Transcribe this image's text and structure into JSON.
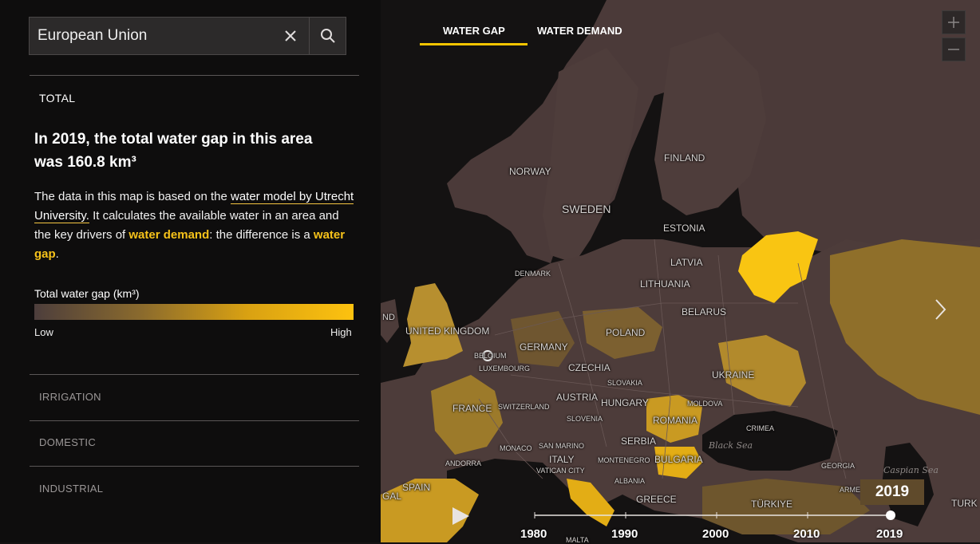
{
  "search": {
    "value": "European Union"
  },
  "categories": {
    "total": "TOTAL",
    "irrigation": "IRRIGATION",
    "domestic": "DOMESTIC",
    "industrial": "INDUSTRIAL"
  },
  "summary": {
    "headline_line1": "In 2019, the total water gap in this area",
    "headline_line2": "was 160.8 km³",
    "desc_part1": "The data in this map is based on the ",
    "desc_link1": "water model by Utrecht University.",
    "desc_part2": " It calculates the available water in an area and the key drivers of ",
    "desc_link2": "water demand",
    "desc_part3": ": the difference is a ",
    "desc_link3": "water gap",
    "desc_part4": "."
  },
  "legend": {
    "title": "Total water gap (km³)",
    "low": "Low",
    "high": "High"
  },
  "tabs": {
    "water_gap": "WATER GAP",
    "water_demand": "WATER DEMAND"
  },
  "zoom": {
    "in": "+",
    "out": "−"
  },
  "countries": {
    "norway": "NORWAY",
    "sweden": "SWEDEN",
    "finland": "FINLAND",
    "estonia": "ESTONIA",
    "latvia": "LATVIA",
    "lithuania": "LITHUANIA",
    "denmark": "DENMARK",
    "belarus": "BELARUS",
    "united_kingdom": "UNITED KINGDOM",
    "ireland_partial": "ND",
    "poland": "POLAND",
    "germany": "GERMANY",
    "belgium": "BELGIUM",
    "luxembourg": "LUXEMBOURG",
    "czechia": "CZECHIA",
    "slovakia": "SLOVAKIA",
    "ukraine": "UKRAINE",
    "austria": "AUSTRIA",
    "hungary": "HUNGARY",
    "moldova": "MOLDOVA",
    "france": "FRANCE",
    "switzerland": "SWITZERLAND",
    "slovenia": "SLOVENIA",
    "romania": "ROMANIA",
    "crimea": "CRIMEA",
    "serbia": "SERBIA",
    "monaco": "MONACO",
    "san_marino": "SAN MARINO",
    "andorra": "ANDORRA",
    "italy": "ITALY",
    "montenegro": "MONTENEGRO",
    "bulgaria": "BULGARIA",
    "georgia": "GEORGIA",
    "vatican": "VATICAN CITY",
    "albania": "ALBANIA",
    "spain": "SPAIN",
    "portugal_partial": "GAL",
    "greece": "GREECE",
    "turkiye": "TÜRKIYE",
    "armenia_partial": "ARME",
    "turkmen_partial": "TURK",
    "malta": "MALTA"
  },
  "seas": {
    "black_sea": "Black Sea",
    "caspian": "Caspian Sea"
  },
  "timeline": {
    "current_year": "2019",
    "ticks": [
      "1980",
      "1990",
      "2000",
      "2010",
      "2019"
    ],
    "progress": 1.0
  },
  "colors": {
    "accent": "#f5c500",
    "land": "#4d3c3a",
    "water": "#141212",
    "gap_high": "#f9c512",
    "gap_mid": "#c99a22"
  },
  "icons": {
    "clear": "close-icon",
    "search": "search-icon",
    "play": "play-icon",
    "next": "chevron-right-icon"
  }
}
